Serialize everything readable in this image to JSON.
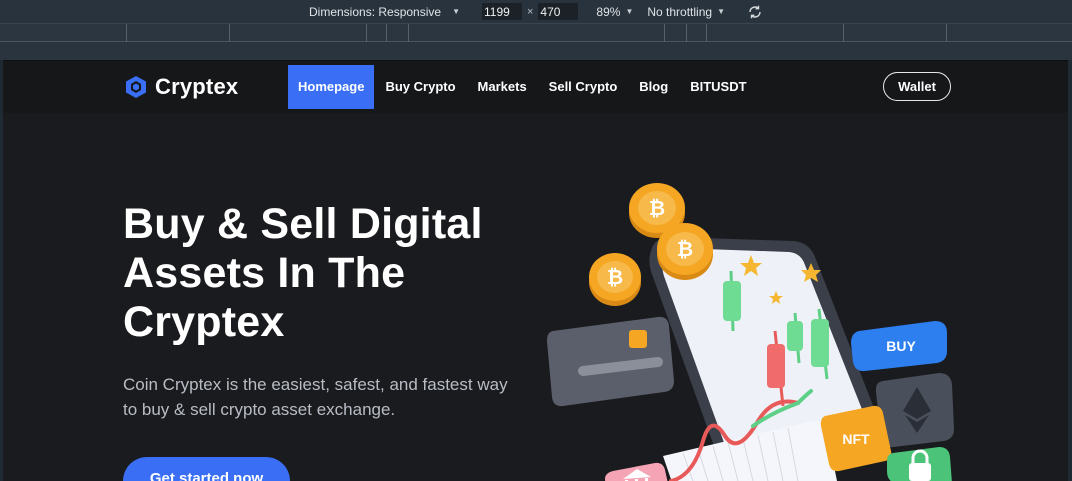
{
  "devtools": {
    "dimensions_label": "Dimensions: Responsive",
    "width": "1199",
    "height": "470",
    "times": "×",
    "zoom": "89%",
    "throttling": "No throttling"
  },
  "site": {
    "brand": "Cryptex",
    "nav": [
      {
        "label": "Homepage",
        "active": true
      },
      {
        "label": "Buy Crypto"
      },
      {
        "label": "Markets"
      },
      {
        "label": "Sell Crypto"
      },
      {
        "label": "Blog"
      },
      {
        "label": "BITUSDT"
      }
    ],
    "wallet_label": "Wallet",
    "hero": {
      "title_line1": "Buy & Sell Digital",
      "title_line2": "Assets In The",
      "title_line3": "Cryptex",
      "description": "Coin Cryptex is the easiest, safest, and fastest way to buy & sell crypto asset exchange.",
      "cta_label": "Get started now"
    },
    "illustration": {
      "buy_tag": "BUY",
      "nft_tag": "NFT",
      "coin_symbol": "₿"
    }
  },
  "colors": {
    "accent": "#3a6ff5",
    "background": "#1a1b1e",
    "coin": "#f5a623"
  }
}
